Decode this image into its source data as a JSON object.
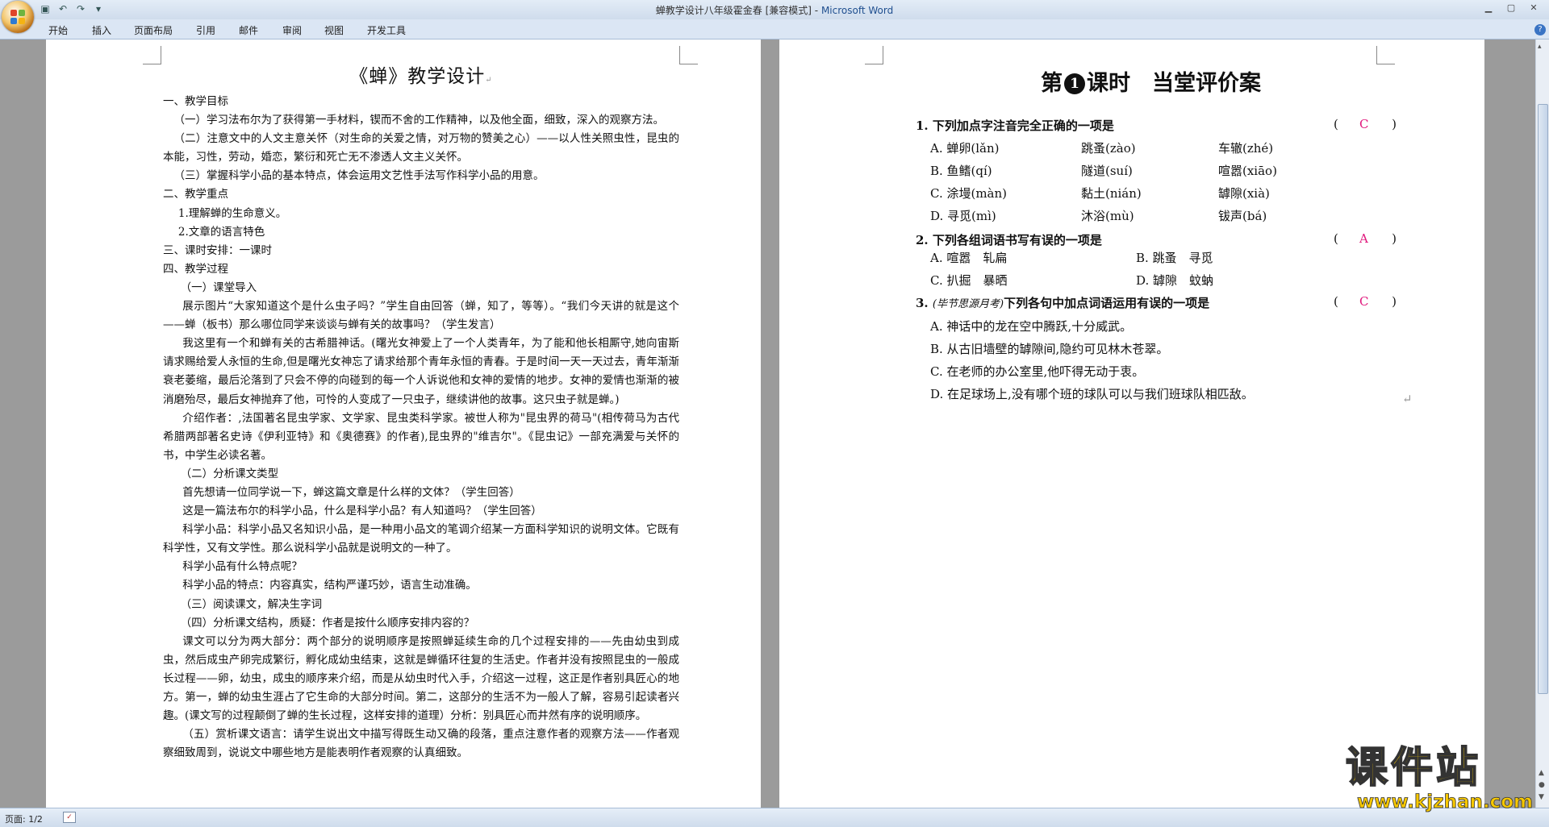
{
  "window": {
    "title": "蝉教学设计八年级霍金春 [兼容模式]",
    "app_name": "Microsoft Word"
  },
  "ribbon": {
    "tabs": [
      "开始",
      "插入",
      "页面布局",
      "引用",
      "邮件",
      "审阅",
      "视图",
      "开发工具"
    ]
  },
  "document_left": {
    "title": "《蝉》教学设计",
    "paragraphs": [
      "一、教学目标",
      "（一）学习法布尔为了获得第一手材料，锲而不舍的工作精神，以及他全面，细致，深入的观察方法。",
      "（二）注意文中的人文主意关怀（对生命的关爱之情，对万物的赞美之心）——以人性关照虫性，昆虫的本能，习性，劳动，婚恋，繁衍和死亡无不渗透人文主义关怀。",
      "（三）掌握科学小品的基本特点，体会运用文艺性手法写作科学小品的用意。",
      "二、教学重点",
      "1.理解蝉的生命意义。",
      "2.文章的语言特色",
      "三、课时安排：一课时",
      "四、教学过程",
      "（一）课堂导入",
      "展示图片“大家知道这个是什么虫子吗？”学生自由回答（蝉，知了，等等）。“我们今天讲的就是这个——蝉（板书）那么哪位同学来谈谈与蝉有关的故事吗？（学生发言）",
      "我这里有一个和蝉有关的古希腊神话。(曙光女神爱上了一个人类青年，为了能和他长相厮守,她向宙斯请求赐给爱人永恒的生命,但是曙光女神忘了请求给那个青年永恒的青春。于是时间一天一天过去，青年渐渐衰老萎缩，最后沦落到了只会不停的向碰到的每一个人诉说他和女神的爱情的地步。女神的爱情也渐渐的被消磨殆尽，最后女神抛弃了他，可怜的人变成了一只虫子，继续讲他的故事。这只虫子就是蝉。)",
      "介绍作者：,法国著名昆虫学家、文学家、昆虫类科学家。被世人称为\"昆虫界的荷马\"(相传荷马为古代希腊两部著名史诗《伊利亚特》和《奥德赛》的作者),昆虫界的\"维吉尔\"。《昆虫记》一部充满爱与关怀的书，中学生必读名著。",
      "（二）分析课文类型",
      "首先想请一位同学说一下，蝉这篇文章是什么样的文体？（学生回答）",
      "这是一篇法布尔的科学小品，什么是科学小品？有人知道吗？（学生回答）",
      "科学小品：科学小品又名知识小品，是一种用小品文的笔调介绍某一方面科学知识的说明文体。它既有科学性，又有文学性。那么说科学小品就是说明文的一种了。",
      "科学小品有什么特点呢？",
      "科学小品的特点：内容真实，结构严谨巧妙，语言生动准确。",
      "（三）阅读课文，解决生字词",
      "（四）分析课文结构，质疑：作者是按什么顺序安排内容的？",
      "课文可以分为两大部分：两个部分的说明顺序是按照蝉延续生命的几个过程安排的——先由幼虫到成虫，然后成虫产卵完成繁衍，孵化成幼虫结束，这就是蝉循环往复的生活史。作者并没有按照昆虫的一般成长过程——卵，幼虫，成虫的顺序来介绍，而是从幼虫时代入手，介绍这一过程，这正是作者别具匠心的地方。第一，蝉的幼虫生涯占了它生命的大部分时间。第二，这部分的生活不为一般人了解，容易引起读者兴趣。(课文写的过程颠倒了蝉的生长过程，这样安排的道理）分析：别具匠心而井然有序的说明顺序。",
      "（五）赏析课文语言：请学生说出文中描写得既生动又确的段落，重点注意作者的观察方法——作者观察细致周到，说说文中哪些地方是能表明作者观察的认真细致。"
    ]
  },
  "document_right": {
    "title_prefix": "第",
    "title_num": "1",
    "title_suffix": "课时　当堂评价案",
    "questions": [
      {
        "stem": "1. 下列加点字注音完全正确的一项是",
        "answer": "C",
        "options": [
          [
            "A. 蝉卵(lǎn)",
            "跳蚤(zào)",
            "车辙(zhé)"
          ],
          [
            "B. 鱼鳍(qí)",
            "隧道(suí)",
            "喧嚣(xiāo)"
          ],
          [
            "C. 涂墁(màn)",
            "黏土(nián)",
            "罅隙(xià)"
          ],
          [
            "D. 寻觅(mì)",
            "沐浴(mù)",
            "钹声(bá)"
          ]
        ]
      },
      {
        "stem": "2. 下列各组词语书写有误的一项是",
        "answer": "A",
        "options": [
          [
            "A. 喧嚣　轧扁",
            "B. 跳蚤　寻觅"
          ],
          [
            "C. 扒掘　暴晒",
            "D. 罅隙　蚊蚋"
          ]
        ]
      },
      {
        "stem_source": "(毕节思源月考)",
        "stem": "下列各句中加点词语运用有误的一项是",
        "number": "3.",
        "answer": "C",
        "options": [
          "A. 神话中的龙在空中腾跃,十分威武。",
          "B. 从古旧墙壁的罅隙间,隐约可见林木苍翠。",
          "C. 在老师的办公室里,他吓得无动于衷。",
          "D. 在足球场上,没有哪个班的球队可以与我们班球队相匹敌。"
        ]
      }
    ]
  },
  "status": {
    "page_indicator": "页面: 1/2"
  },
  "watermark": {
    "text": "课件站",
    "url": "www.kjzhan.com"
  },
  "colors": {
    "answer": "#e0177c",
    "watermark": "#f7c800"
  }
}
